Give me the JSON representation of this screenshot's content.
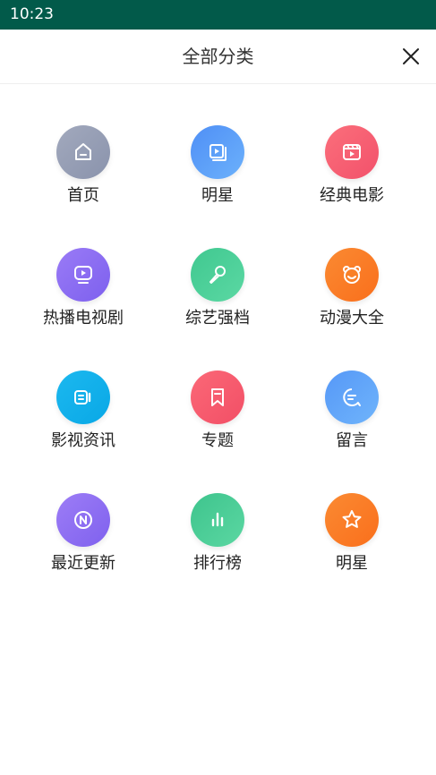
{
  "status_bar": {
    "time": "10:23"
  },
  "header": {
    "title": "全部分类",
    "close_icon": "close-icon"
  },
  "categories": [
    {
      "label": "首页",
      "icon": "home-icon",
      "gradient": [
        "#a2a9bd",
        "#8a93ac"
      ]
    },
    {
      "label": "明星",
      "icon": "video-frame-icon",
      "gradient": [
        "#4f8ff6",
        "#6cb1fb"
      ]
    },
    {
      "label": "经典电影",
      "icon": "film-icon",
      "gradient": [
        "#fb6f7b",
        "#f2516b"
      ]
    },
    {
      "label": "热播电视剧",
      "icon": "tv-play-icon",
      "gradient": [
        "#9a7bf6",
        "#7d60ee"
      ]
    },
    {
      "label": "综艺强档",
      "icon": "microphone-icon",
      "gradient": [
        "#40c890",
        "#5bd8a3"
      ]
    },
    {
      "label": "动漫大全",
      "icon": "bear-face-icon",
      "gradient": [
        "#fb8a32",
        "#f96f1c"
      ]
    },
    {
      "label": "影视资讯",
      "icon": "video-camera-icon",
      "gradient": [
        "#1cb8ef",
        "#09a8e6"
      ]
    },
    {
      "label": "专题",
      "icon": "bookmark-icon",
      "gradient": [
        "#fb6877",
        "#f24f66"
      ]
    },
    {
      "label": "留言",
      "icon": "chat-bubble-icon",
      "gradient": [
        "#5698f7",
        "#6fb4fb"
      ]
    },
    {
      "label": "最近更新",
      "icon": "new-badge-icon",
      "gradient": [
        "#9d7df6",
        "#7f61ee"
      ]
    },
    {
      "label": "排行榜",
      "icon": "bar-chart-icon",
      "gradient": [
        "#3ec48d",
        "#5bd7a2"
      ]
    },
    {
      "label": "明星",
      "icon": "star-icon",
      "gradient": [
        "#fb8a32",
        "#f96f1c"
      ]
    }
  ]
}
